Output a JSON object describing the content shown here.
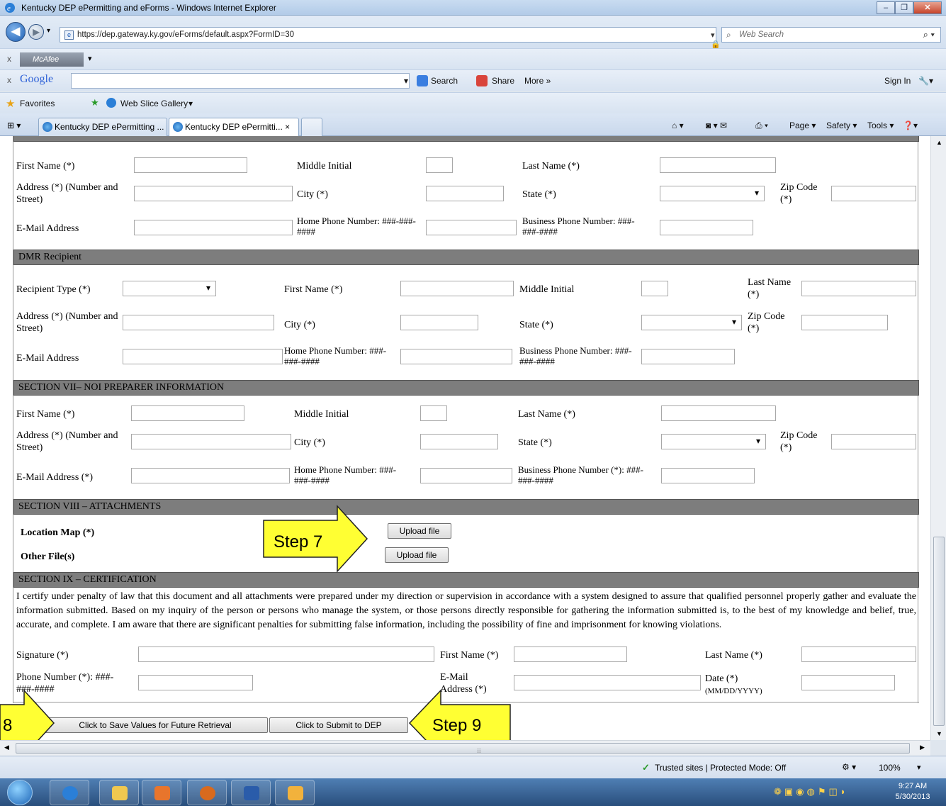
{
  "window": {
    "title": "Kentucky DEP ePermitting and eForms - Windows Internet Explorer",
    "url": "https://dep.gateway.ky.gov/eForms/default.aspx?FormID=30",
    "search_placeholder": "Web Search"
  },
  "toolbars": {
    "mcafee": "McAfee",
    "google": "Google",
    "search": "Search",
    "share": "Share",
    "more": "More »",
    "sign_in": "Sign In",
    "favorites": "Favorites",
    "web_slice": "Web Slice Gallery"
  },
  "tabs": [
    {
      "label": "Kentucky DEP ePermitting ..."
    },
    {
      "label": "Kentucky DEP ePermitti... ×"
    }
  ],
  "commands": {
    "page": "Page ▾",
    "safety": "Safety ▾",
    "tools": "Tools ▾"
  },
  "form": {
    "signatory": {
      "first_name": "First Name (*)",
      "middle_initial": "Middle Initial",
      "last_name": "Last Name (*)",
      "address": "Address (*) (Number and Street)",
      "city": "City (*)",
      "state": "State (*)",
      "zip": "Zip Code (*)",
      "email": "E-Mail Address",
      "home_phone": "Home Phone Number: ###-###-####",
      "business_phone": "Business Phone Number: ###-###-####"
    },
    "recipient": {
      "header": "DMR Recipient",
      "recipient_type": "Recipient Type (*)",
      "first_name": "First Name (*)",
      "middle_initial": "Middle Initial",
      "last_name": "Last Name (*)",
      "address": "Address (*) (Number and Street)",
      "city": "City (*)",
      "state": "State (*)",
      "zip": "Zip Code (*)",
      "email": "E-Mail Address",
      "home_phone": "Home Phone Number: ###-###-####",
      "business_phone": "Business Phone Number: ###-###-####"
    },
    "preparer": {
      "header": "SECTION VII– NOI PREPARER INFORMATION",
      "first_name": "First Name (*)",
      "middle_initial": "Middle Initial",
      "last_name": "Last Name (*)",
      "address": "Address (*) (Number and Street)",
      "city": "City (*)",
      "state": "State (*)",
      "zip": "Zip Code (*)",
      "email": "E-Mail Address (*)",
      "home_phone": "Home Phone Number: ###-###-####",
      "business_phone": "Business Phone Number (*): ###-###-####"
    },
    "attachments": {
      "header": "SECTION VIII – ATTACHMENTS",
      "location_map": "Location Map (*)",
      "other_files": "Other File(s)",
      "upload": "Upload file"
    },
    "certification": {
      "header": "SECTION IX – CERTIFICATION",
      "text": "I certify under penalty of law that this document and all attachments were prepared under my direction or supervision in accordance with a system designed to assure that qualified personnel properly gather and evaluate the information submitted. Based on my inquiry of the person or persons who manage the system, or those persons directly responsible for gathering the information submitted is, to the best of my knowledge and belief, true, accurate, and complete. I am aware that there are significant penalties for submitting false information, including the possibility of fine and imprisonment for knowing violations.",
      "signature": "Signature (*)",
      "first_name": "First Name (*)",
      "last_name": "Last Name (*)",
      "phone": "Phone Number (*): ###-###-####",
      "email": "E-Mail Address (*)",
      "date": "Date (*)",
      "date_format": "(MM/DD/YYYY)"
    },
    "buttons": {
      "save": "Click to Save Values for Future Retrieval",
      "submit": "Click to Submit to DEP"
    }
  },
  "annotations": {
    "step7": "Step 7",
    "step8": "8",
    "step9": "Step 9"
  },
  "status": {
    "zone": "Trusted sites | Protected Mode: Off",
    "zoom": "100%"
  },
  "clock": {
    "time": "9:27 AM",
    "date": "5/30/2013"
  }
}
